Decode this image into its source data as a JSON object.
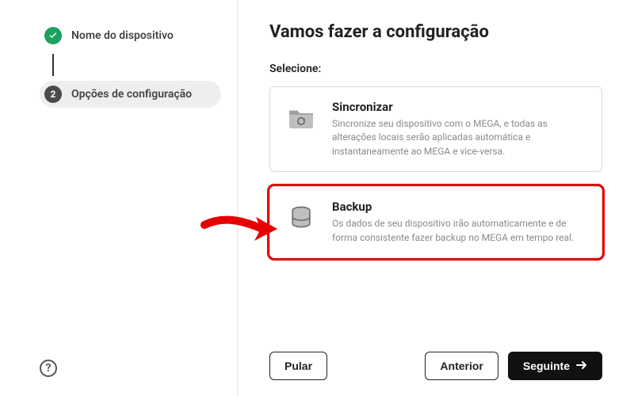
{
  "sidebar": {
    "steps": [
      {
        "label": "Nome do dispositivo",
        "state": "done"
      },
      {
        "label": "Opções de configuração",
        "state": "current",
        "num": "2"
      }
    ]
  },
  "main": {
    "title": "Vamos fazer a configuração",
    "prompt": "Selecione:",
    "options": {
      "sync": {
        "title": "Sincronizar",
        "desc": "Sincronize seu dispositivo com o MEGA, e todas as alterações locais serão aplicadas automática e instantaneamente ao MEGA e vice-versa."
      },
      "backup": {
        "title": "Backup",
        "desc": "Os dados de seu dispositivo irão automaticamente e de forma consistente fazer backup no MEGA em tempo real."
      }
    }
  },
  "footer": {
    "skip": "Pular",
    "prev": "Anterior",
    "next": "Seguinte"
  },
  "help": {
    "glyph": "?"
  },
  "colors": {
    "accent_highlight": "#e60000",
    "primary_btn": "#111111",
    "success": "#1aa260"
  }
}
